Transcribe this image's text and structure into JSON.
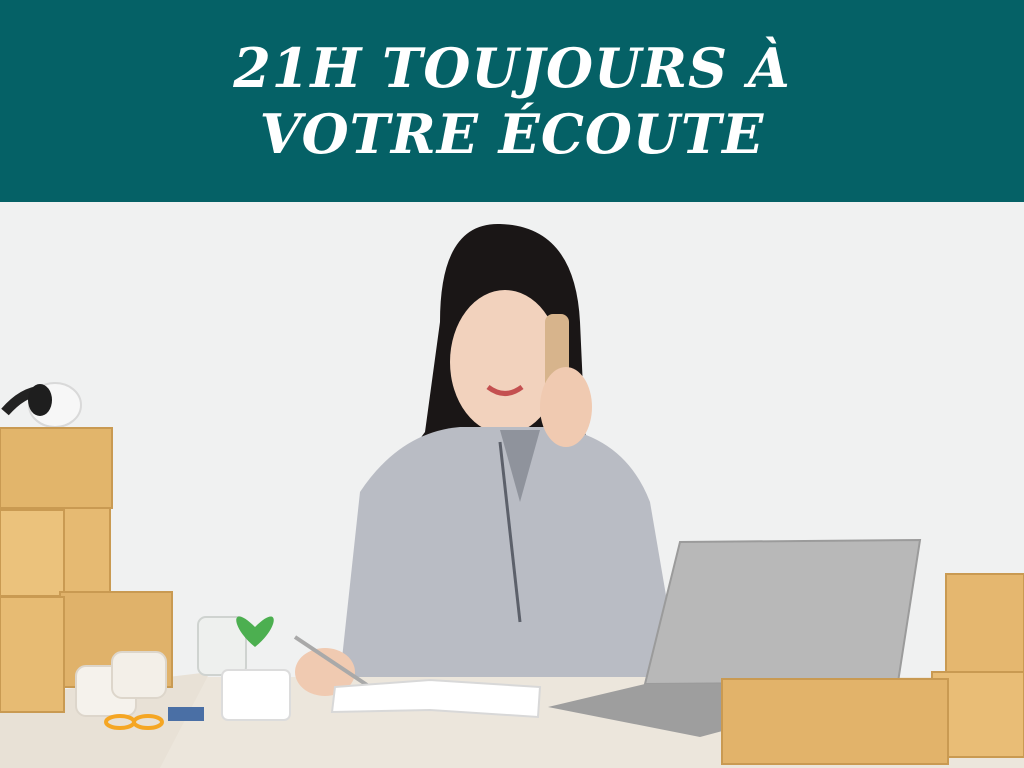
{
  "banner": {
    "headline_line1": "21H TOUJOURS À",
    "headline_line2": "VOTRE ÉCOUTE",
    "background_color": "#056166",
    "text_color": "#ffffff"
  },
  "photo": {
    "icon": "customer-service-photo"
  }
}
